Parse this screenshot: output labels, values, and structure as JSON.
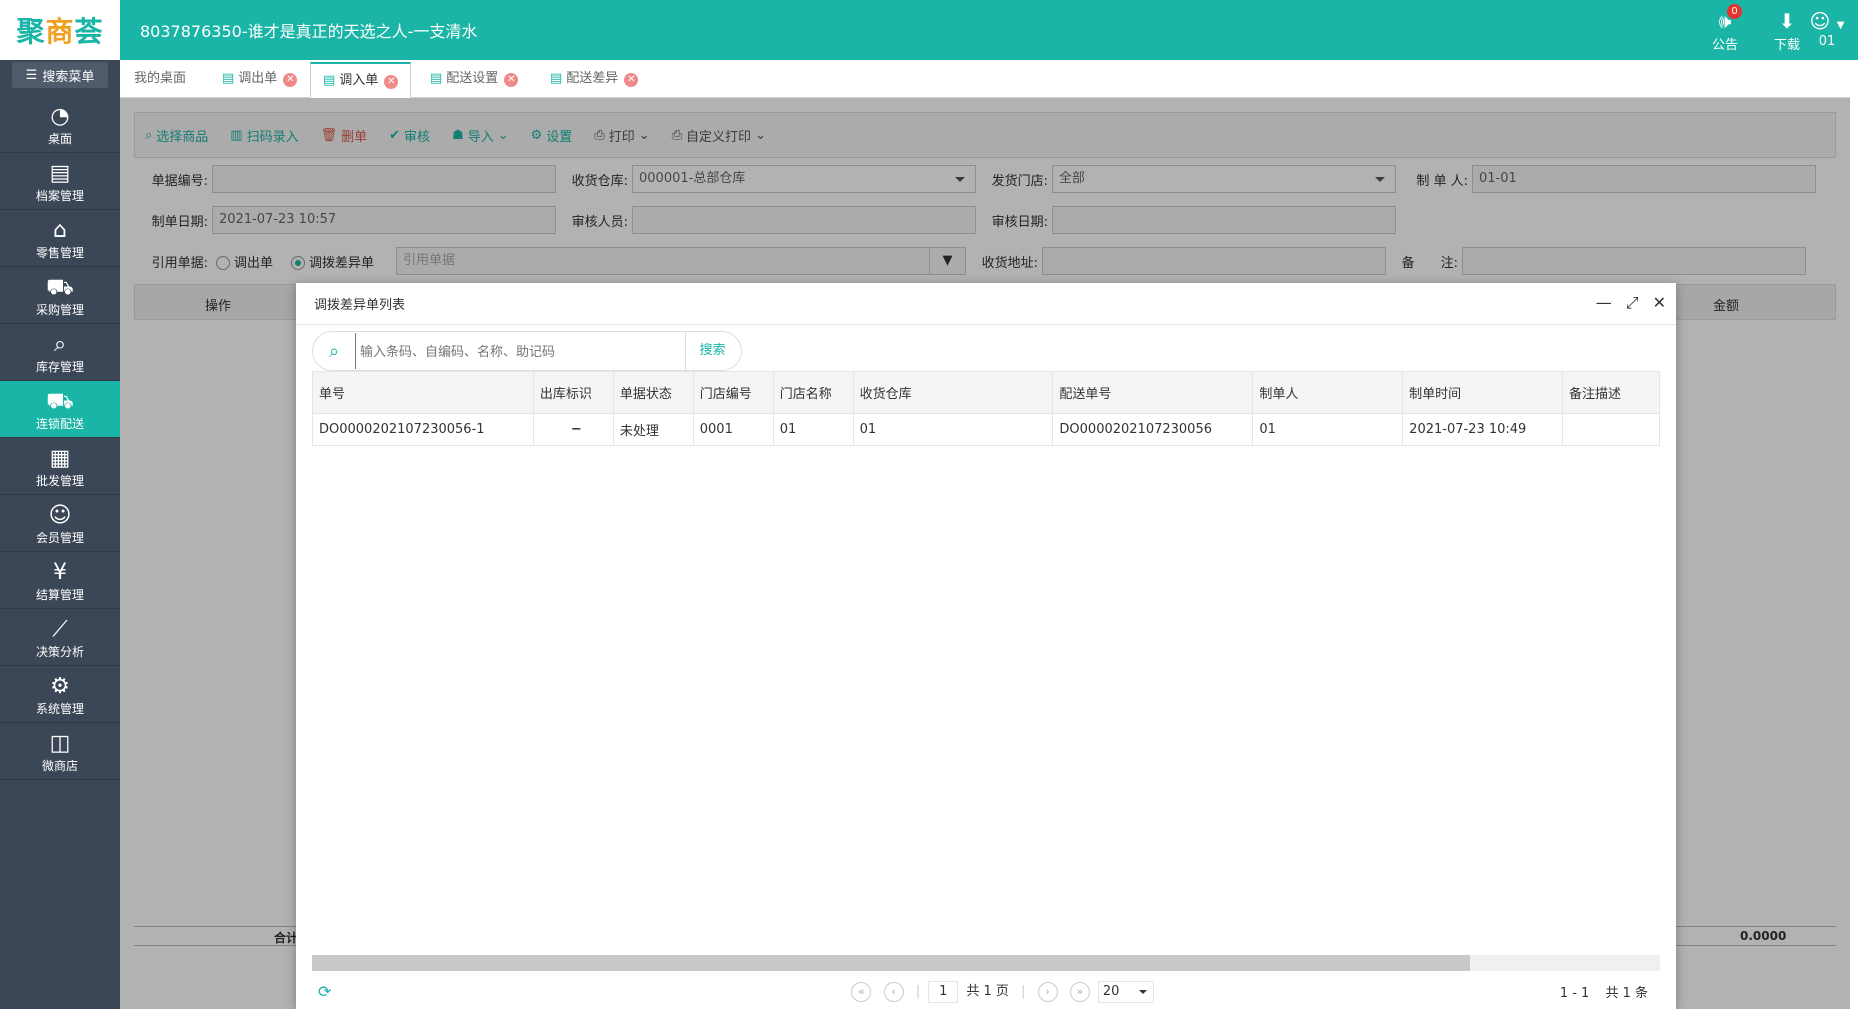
{
  "app": {
    "logo_text_1": "聚",
    "logo_text_2": "商",
    "logo_text_3": "荟",
    "title": "8037876350-谁才是真正的天选之人-一支清水",
    "notice_label": "公告",
    "notice_count": "0",
    "download_label": "下载",
    "user_label": "01"
  },
  "sidebar": {
    "search_label": "搜索菜单",
    "items": [
      {
        "label": "桌面",
        "icon": "dashboard-icon"
      },
      {
        "label": "档案管理",
        "icon": "archive-icon"
      },
      {
        "label": "零售管理",
        "icon": "store-icon"
      },
      {
        "label": "采购管理",
        "icon": "cart-icon"
      },
      {
        "label": "库存管理",
        "icon": "inventory-icon"
      },
      {
        "label": "连锁配送",
        "icon": "truck-icon"
      },
      {
        "label": "批发管理",
        "icon": "wholesale-icon"
      },
      {
        "label": "会员管理",
        "icon": "member-icon"
      },
      {
        "label": "结算管理",
        "icon": "settlement-icon"
      },
      {
        "label": "决策分析",
        "icon": "chart-icon"
      },
      {
        "label": "系统管理",
        "icon": "gear-icon"
      },
      {
        "label": "微商店",
        "icon": "shop-icon"
      }
    ]
  },
  "tabs": [
    {
      "label": "我的桌面"
    },
    {
      "label": "调出单"
    },
    {
      "label": "调入单"
    },
    {
      "label": "配送设置"
    },
    {
      "label": "配送差异"
    }
  ],
  "toolbar": {
    "select_goods": "选择商品",
    "scan": "扫码录入",
    "delete": "删单",
    "audit": "审核",
    "import": "导入",
    "settings": "设置",
    "print": "打印",
    "custom_print": "自定义打印"
  },
  "form": {
    "doc_no_label": "单据编号:",
    "doc_no_value": "",
    "warehouse_label": "收货仓库:",
    "warehouse_value": "000001-总部仓库",
    "ship_store_label": "发货门店:",
    "ship_store_value": "全部",
    "maker_label": "制 单 人:",
    "maker_value": "01-01",
    "date_label": "制单日期:",
    "date_value": "2021-07-23 10:57",
    "auditor_label": "审核人员:",
    "auditor_value": "",
    "audit_date_label": "审核日期:",
    "audit_date_value": "",
    "ref_label": "引用单据:",
    "ref_opt1": "调出单",
    "ref_opt2": "调拨差异单",
    "ref_placeholder": "引用单据",
    "address_label": "收货地址:",
    "address_value": "",
    "remark_label": "备　　注:",
    "remark_value": ""
  },
  "grid": {
    "op_header": "操作",
    "amount_header": "金额",
    "total_label": "合计",
    "total_amount": "0.0000"
  },
  "modal": {
    "title": "调拨差异单列表",
    "search_placeholder": "输入条码、自编码、名称、助记码",
    "search_button": "搜索",
    "columns": [
      "单号",
      "出库标识",
      "单据状态",
      "门店编号",
      "门店名称",
      "收货仓库",
      "配送单号",
      "制单人",
      "制单时间",
      "备注描述"
    ],
    "rows": [
      {
        "doc_no": "DO0000202107230056-1",
        "out_flag": "−",
        "status": "未处理",
        "store_no": "0001",
        "store_name": "01",
        "warehouse": "01",
        "delivery_no": "DO0000202107230056",
        "maker": "01",
        "time": "2021-07-23 10:49",
        "remark": ""
      }
    ],
    "pager": {
      "page": "1",
      "total_pages": "共 1 页",
      "page_size": "20",
      "range": "1 - 1",
      "total_items": "共 1 条"
    }
  }
}
